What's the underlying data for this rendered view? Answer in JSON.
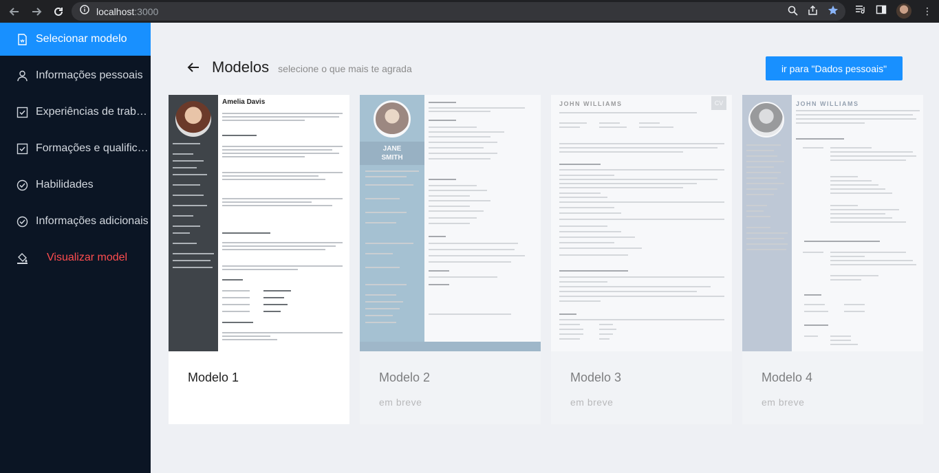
{
  "browser": {
    "url_host": "localhost",
    "url_port": ":3000"
  },
  "sidebar": {
    "items": [
      {
        "label": "Selecionar modelo",
        "icon": "document-icon"
      },
      {
        "label": "Informações pessoais",
        "icon": "user-icon"
      },
      {
        "label": "Experiências de trabalho",
        "icon": "checkbox-icon"
      },
      {
        "label": "Formações e qualificações",
        "icon": "checkbox-icon"
      },
      {
        "label": "Habilidades",
        "icon": "check-circle-icon"
      },
      {
        "label": "Informações adicionais",
        "icon": "check-circle-icon"
      },
      {
        "label": "Visualizar model",
        "icon": "paint-bucket-icon"
      }
    ]
  },
  "header": {
    "title": "Modelos",
    "subtitle": "selecione o que mais te agrada",
    "next_button": "ir para \"Dados pessoais\""
  },
  "cards": [
    {
      "title": "Modelo 1",
      "desc": "",
      "thumb": {
        "name": "Amelia Davis"
      }
    },
    {
      "title": "Modelo 2",
      "desc": "em breve",
      "thumb": {
        "name_line1": "JANE",
        "name_line2": "SMITH"
      }
    },
    {
      "title": "Modelo 3",
      "desc": "em breve",
      "thumb": {
        "name": "JOHN WILLIAMS",
        "badge": "CV"
      }
    },
    {
      "title": "Modelo 4",
      "desc": "em breve",
      "thumb": {
        "name": "JOHN WILLIAMS"
      }
    }
  ],
  "colors": {
    "primary": "#1890ff",
    "sidebar_bg": "#0b1524",
    "danger": "#ff4d4f"
  }
}
